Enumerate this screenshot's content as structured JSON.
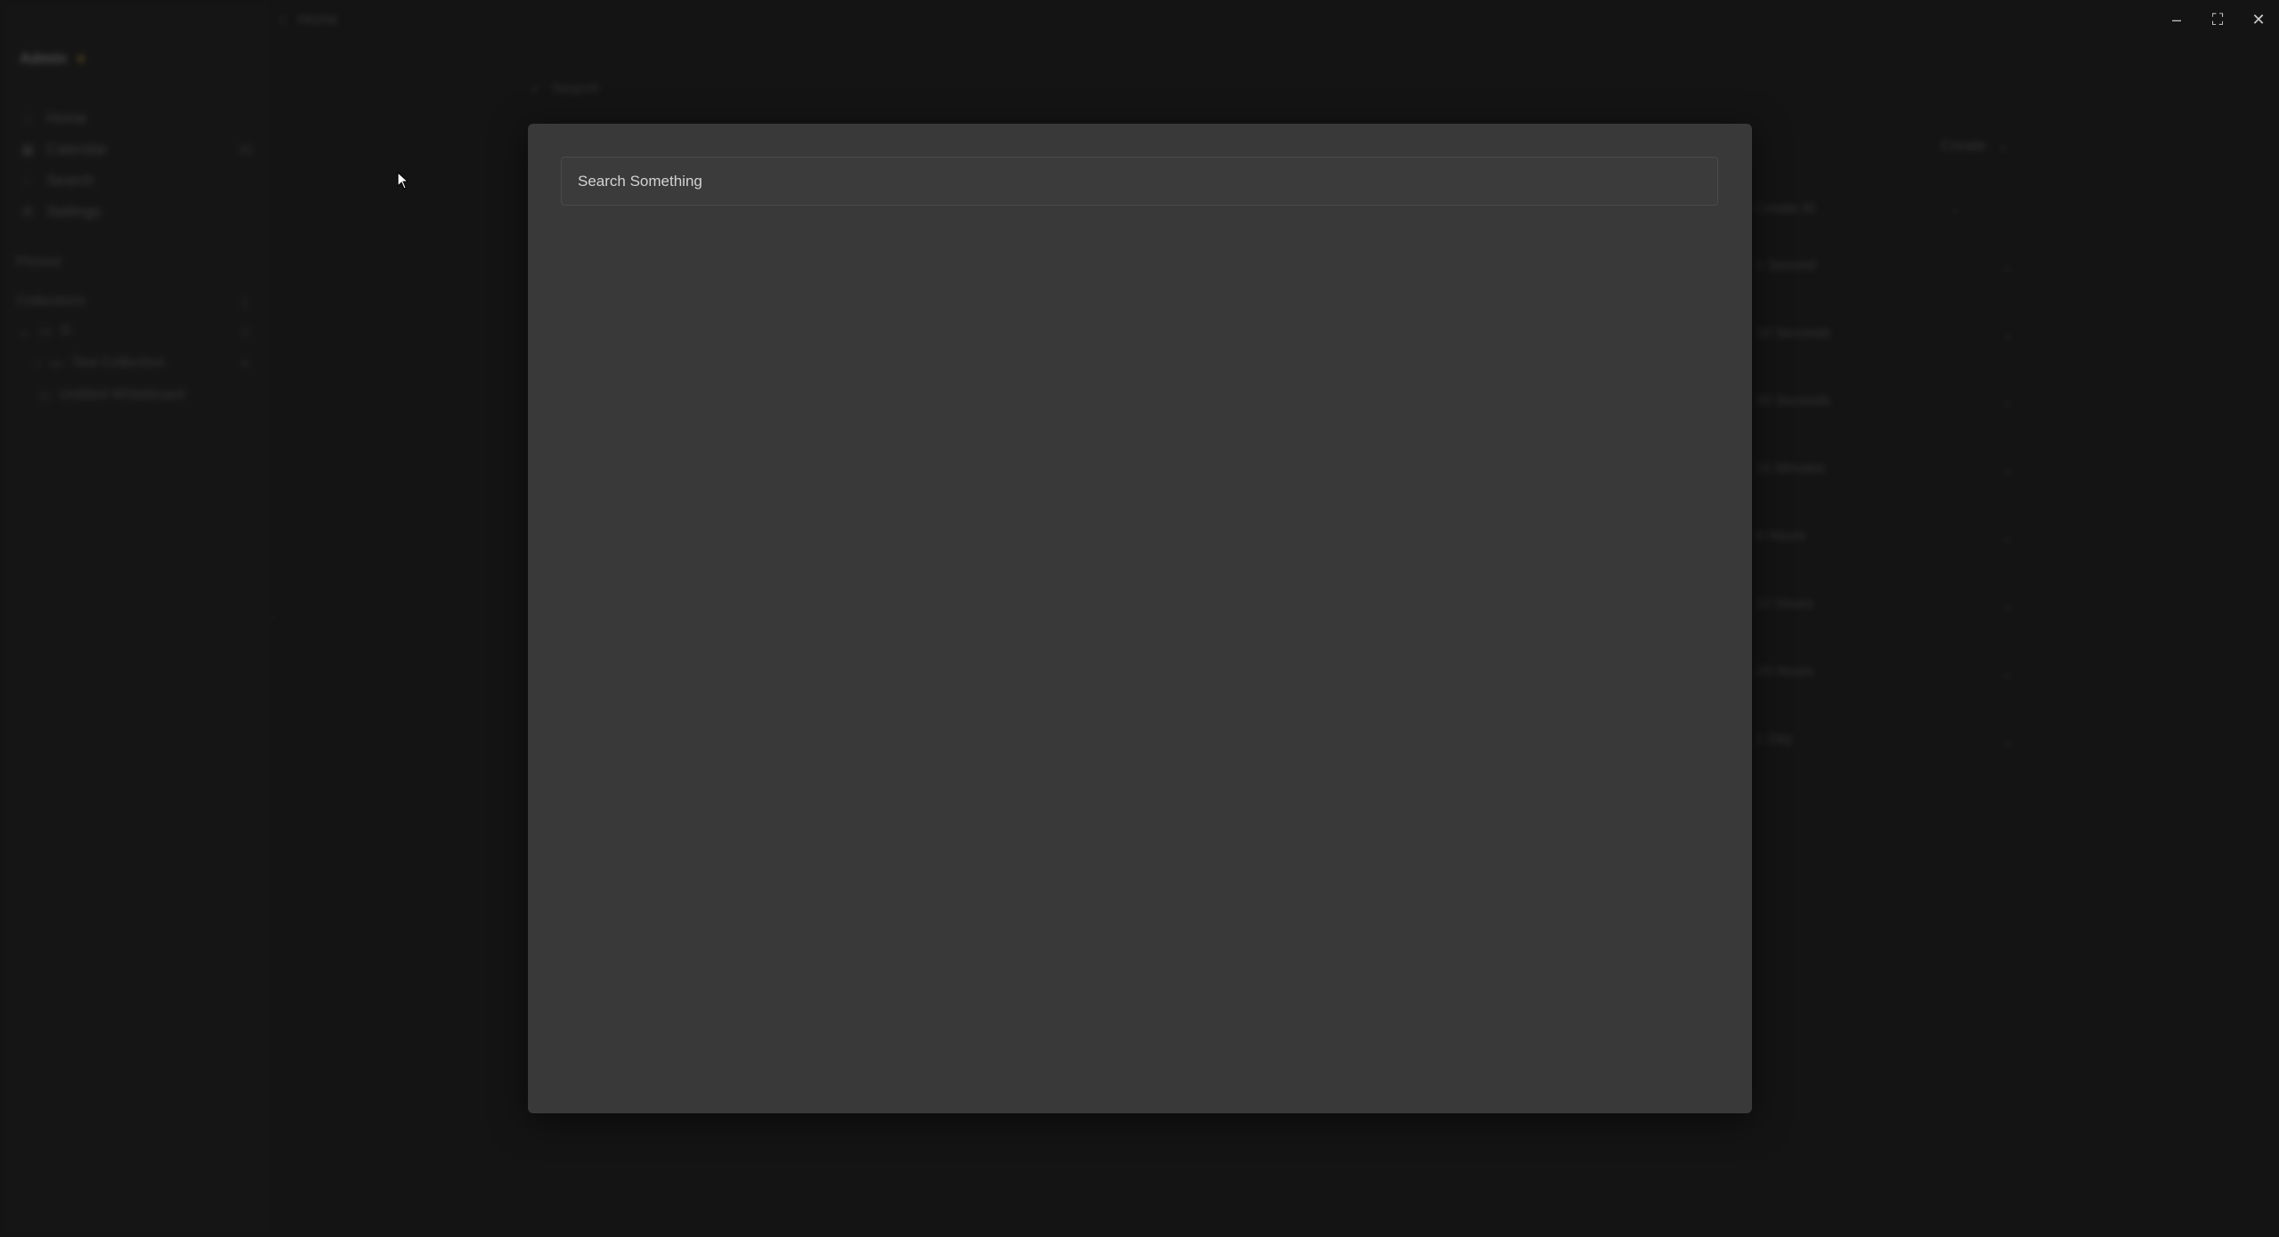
{
  "window": {
    "crumb_label": "Home"
  },
  "sidebar": {
    "user_name": "Admin",
    "nav": [
      {
        "label": "Home",
        "icon": "home-icon",
        "count": ""
      },
      {
        "label": "Calendar",
        "icon": "calendar-icon",
        "count": "31"
      },
      {
        "label": "Search",
        "icon": "search-icon",
        "count": ""
      },
      {
        "label": "Settings",
        "icon": "gear-icon",
        "count": ""
      }
    ],
    "pinned_label": "Pinned",
    "collections_label": "Collections",
    "collections_count": "1",
    "tree": [
      {
        "label": "D",
        "count": "2"
      },
      {
        "label": "Test Collection",
        "count": "0"
      },
      {
        "label": "Untitled Whiteboard",
        "count": ""
      }
    ]
  },
  "main": {
    "search_label": "Search",
    "create_label": "Create",
    "time_header": "Create At",
    "time_rows": [
      "1 Second",
      "10 Seconds",
      "30 Seconds",
      "15 Minutes",
      "8 Hours",
      "12 Hours",
      "24 Hours",
      "1 Day"
    ]
  },
  "modal": {
    "search_placeholder": "Search Something",
    "search_value": ""
  }
}
